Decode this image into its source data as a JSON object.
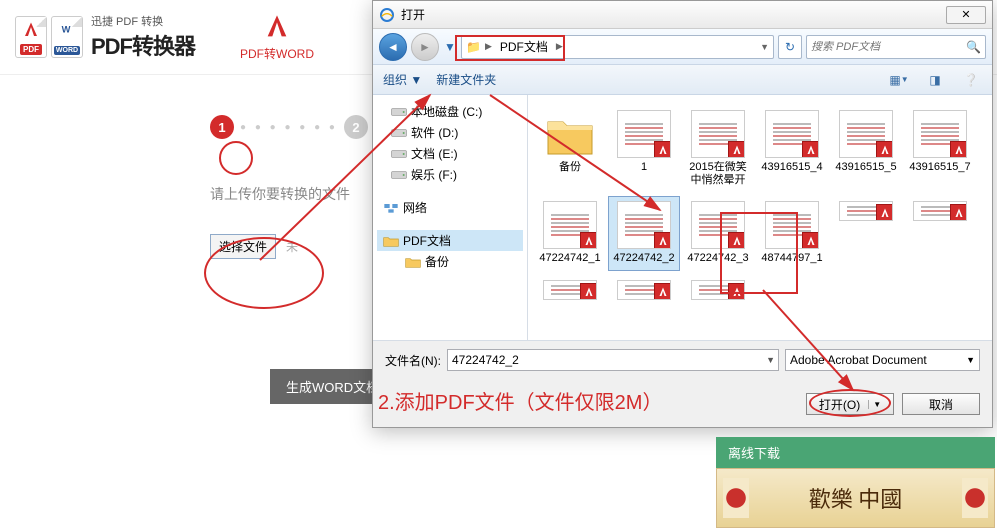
{
  "header": {
    "logo_sub": "迅捷 PDF 转换",
    "logo_main": "PDF转换器",
    "pdf_label": "PDF",
    "word_label": "WORD",
    "nav_pdf2word": "PDF转WORD"
  },
  "wizard": {
    "step1": "1",
    "step2": "2",
    "upload_hint": "请上传你要转换的文件",
    "choose_file": "选择文件",
    "not_selected": "未",
    "gen_word": "生成WORD文档"
  },
  "dialog": {
    "title": "打开",
    "path_root_icon": "📁",
    "path_seg1": "PDF文档",
    "search_placeholder": "搜索 PDF文档",
    "organize": "组织",
    "new_folder": "新建文件夹",
    "tree": {
      "drive_c": "本地磁盘 (C:)",
      "drive_d": "软件 (D:)",
      "drive_e": "文档 (E:)",
      "drive_f": "娱乐 (F:)",
      "network": "网络",
      "folder_pdf": "PDF文档",
      "folder_backup": "备份"
    },
    "files": [
      {
        "label": "备份",
        "type": "folder"
      },
      {
        "label": "1",
        "type": "pdf"
      },
      {
        "label": "2015在微笑中悄然晕开",
        "type": "pdf"
      },
      {
        "label": "43916515_4",
        "type": "pdf"
      },
      {
        "label": "43916515_5",
        "type": "pdf"
      },
      {
        "label": "43916515_7",
        "type": "pdf"
      },
      {
        "label": "47224742_1",
        "type": "pdf"
      },
      {
        "label": "47224742_2",
        "type": "pdf",
        "selected": true
      },
      {
        "label": "47224742_3",
        "type": "pdf"
      },
      {
        "label": "48744797_1",
        "type": "pdf"
      }
    ],
    "filename_label": "文件名(N):",
    "filename_value": "47224742_2",
    "filetype": "Adobe Acrobat Document",
    "open_btn": "打开(O)",
    "cancel_btn": "取消"
  },
  "annotation": {
    "step2_text": "2.添加PDF文件（文件仅限2M）"
  },
  "sidebar": {
    "offline": "离线下载",
    "banner": "歡樂 中國"
  }
}
